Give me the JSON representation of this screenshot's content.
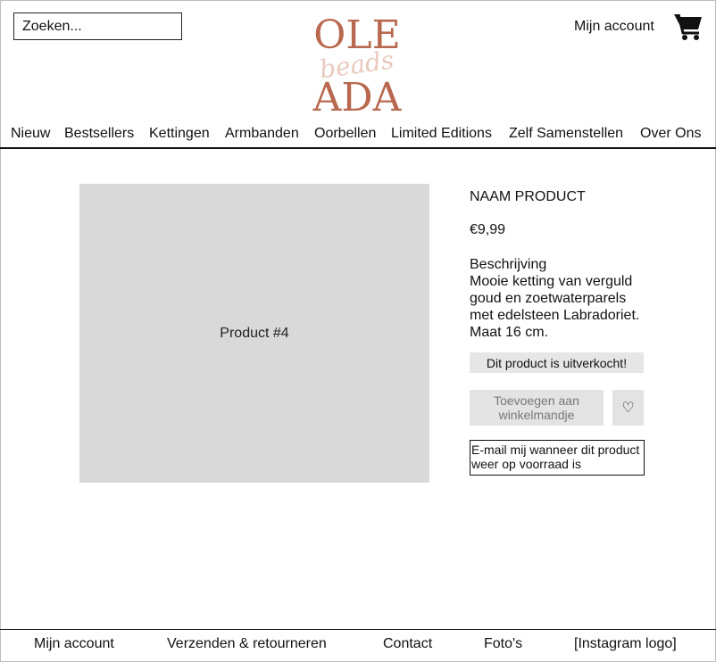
{
  "header": {
    "search_placeholder": "Zoeken...",
    "account_label": "Mijn account",
    "logo": {
      "line1": "OLE",
      "script": "beads",
      "line2": "ADA",
      "color": "#b8684f",
      "script_color": "#e8c9bd"
    },
    "cart_icon": "shopping-cart-icon"
  },
  "nav": {
    "items": [
      "Nieuw",
      "Bestsellers",
      "Kettingen",
      "Armbanden",
      "Oorbellen",
      "Limited Editions",
      "Zelf Samenstellen",
      "Over Ons"
    ]
  },
  "product": {
    "image_label": "Product #4",
    "name": "NAAM PRODUCT",
    "price": "€9,99",
    "description_title": "Beschrijving",
    "description": "Mooie ketting van verguld goud en zoetwaterparels met edelsteen Labradoriet. Maat 16 cm.",
    "soldout_label": "Dit product is uitverkocht!",
    "add_to_cart_label": "Toevoegen aan winkelmandje",
    "favorite_icon": "heart-icon",
    "favorite_glyph": "♡",
    "notify_label": "E-mail mij wanneer dit product weer op voorraad is"
  },
  "footer": {
    "items": [
      "Mijn account",
      "Verzenden & retourneren",
      "Contact",
      "Foto's",
      "[Instagram logo]"
    ]
  }
}
